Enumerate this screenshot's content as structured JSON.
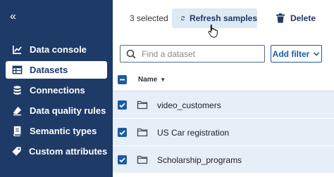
{
  "sidebar": {
    "collapse_glyph": "«",
    "items": [
      {
        "label": "Data console",
        "icon": "chart-line-icon",
        "active": false
      },
      {
        "label": "Datasets",
        "icon": "table-icon",
        "active": true
      },
      {
        "label": "Connections",
        "icon": "database-icon",
        "active": false
      },
      {
        "label": "Data quality rules",
        "icon": "eraser-icon",
        "active": false
      },
      {
        "label": "Semantic types",
        "icon": "book-icon",
        "active": false
      },
      {
        "label": "Custom attributes",
        "icon": "tag-icon",
        "active": false
      }
    ]
  },
  "toolbar": {
    "selected_text": "3 selected",
    "refresh_label": "Refresh samples",
    "delete_label": "Delete"
  },
  "search": {
    "placeholder": "Find a dataset",
    "value": ""
  },
  "filter": {
    "label": "Add filter"
  },
  "table": {
    "name_header": "Name",
    "sort_glyph": "▼",
    "rows": [
      {
        "name": "video_customers",
        "checked": true
      },
      {
        "name": "US Car registration",
        "checked": true
      },
      {
        "name": "Scholarship_programs",
        "checked": true
      }
    ]
  },
  "colors": {
    "sidebar_bg": "#1e3a66",
    "accent": "#1e5aa0",
    "row_selected_bg": "#e6eef8",
    "refresh_bg": "#dde9f4"
  }
}
